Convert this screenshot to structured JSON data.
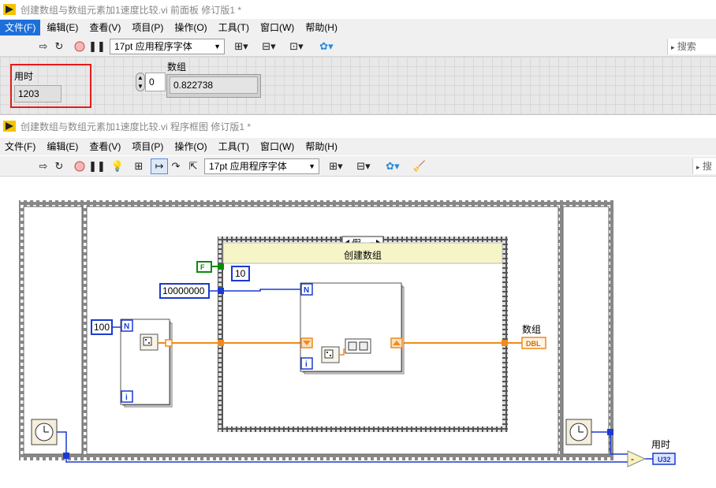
{
  "front_panel": {
    "window_title": "创建数组与数组元素加1速度比较.vi 前面板 修订版1 *",
    "menu": [
      "文件(F)",
      "编辑(E)",
      "查看(V)",
      "项目(P)",
      "操作(O)",
      "工具(T)",
      "窗口(W)",
      "帮助(H)"
    ],
    "font_selector": "17pt 应用程序字体",
    "search_placeholder": "搜索",
    "time_label": "用时",
    "time_value": "1203",
    "array_label": "数组",
    "array_index": "0",
    "array_value": "0.822738"
  },
  "block_diagram": {
    "window_title": "创建数组与数组元素加1速度比较.vi 程序框图 修订版1 *",
    "menu": [
      "文件(F)",
      "编辑(E)",
      "查看(V)",
      "项目(P)",
      "操作(O)",
      "工具(T)",
      "窗口(W)",
      "帮助(H)"
    ],
    "font_selector": "17pt 应用程序字体",
    "search_placeholder": "搜",
    "case_selector": "假",
    "case_label": "创建数组",
    "bool_const": "F",
    "const_10": "10",
    "const_10000000": "10000000",
    "const_100": "100",
    "n_terminal": "N",
    "i_terminal": "i",
    "array_indicator_label": "数组",
    "array_indicator_type": "DBL",
    "time_indicator_label": "用时",
    "time_indicator_type": "U32",
    "subtract_symbol": "-"
  },
  "colors": {
    "orange_wire": "#f08a1c",
    "blue_wire": "#1a3ad0",
    "green_bool": "#0a8a0a",
    "menu_highlight": "#1e6fd9",
    "highlight_box": "#e51b1b",
    "case_label_bg": "#f5f5c8"
  }
}
